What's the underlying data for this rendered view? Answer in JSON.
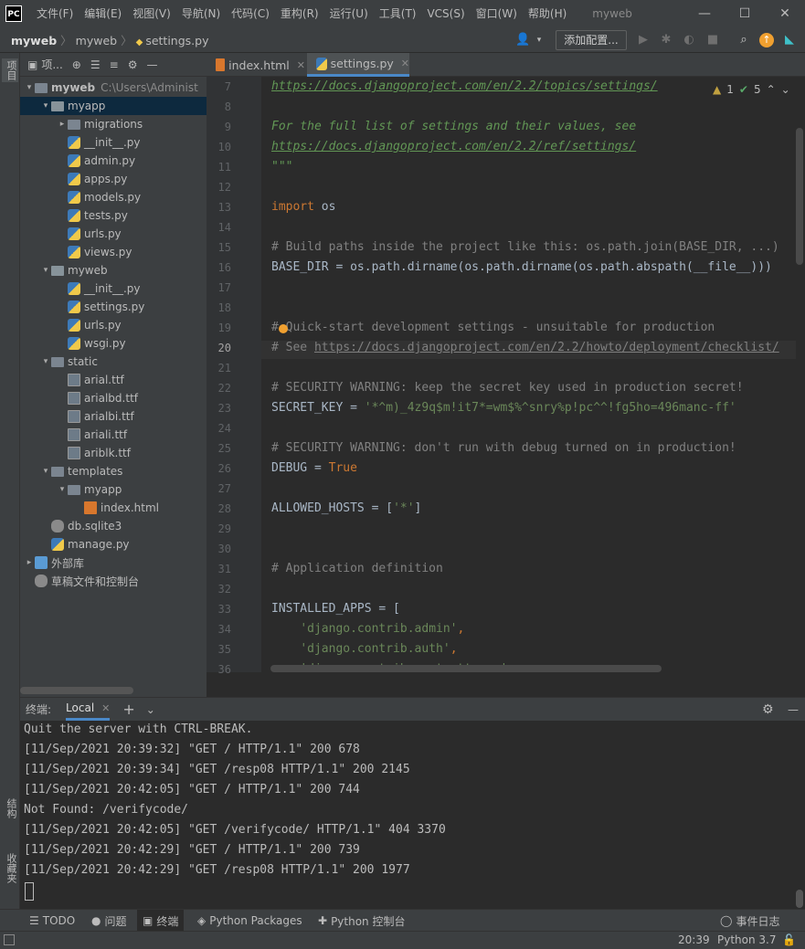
{
  "menubar": {
    "logo": "PC",
    "items": [
      "文件(F)",
      "编辑(E)",
      "视图(V)",
      "导航(N)",
      "代码(C)",
      "重构(R)",
      "运行(U)",
      "工具(T)",
      "VCS(S)",
      "窗口(W)",
      "帮助(H)"
    ],
    "title": "myweb"
  },
  "navbar": {
    "crumbs": [
      "myweb",
      "myweb",
      "settings.py"
    ],
    "run_config": "添加配置..."
  },
  "leftstrip": {
    "project": "项目",
    "structure": "结构",
    "favorites": "收藏夹"
  },
  "project": {
    "header": "项...",
    "tree": [
      {
        "label": "myweb",
        "extra": "C:\\Users\\Administ",
        "indent": 0,
        "arrow": "▾",
        "icon": "folder",
        "bold": true
      },
      {
        "label": "myapp",
        "indent": 1,
        "arrow": "▾",
        "icon": "folder-p",
        "selected": true
      },
      {
        "label": "migrations",
        "indent": 2,
        "arrow": "▸",
        "icon": "folder"
      },
      {
        "label": "__init__.py",
        "indent": 2,
        "icon": "py"
      },
      {
        "label": "admin.py",
        "indent": 2,
        "icon": "py"
      },
      {
        "label": "apps.py",
        "indent": 2,
        "icon": "py"
      },
      {
        "label": "models.py",
        "indent": 2,
        "icon": "py"
      },
      {
        "label": "tests.py",
        "indent": 2,
        "icon": "py"
      },
      {
        "label": "urls.py",
        "indent": 2,
        "icon": "py"
      },
      {
        "label": "views.py",
        "indent": 2,
        "icon": "py"
      },
      {
        "label": "myweb",
        "indent": 1,
        "arrow": "▾",
        "icon": "folder-p"
      },
      {
        "label": "__init__.py",
        "indent": 2,
        "icon": "py"
      },
      {
        "label": "settings.py",
        "indent": 2,
        "icon": "py"
      },
      {
        "label": "urls.py",
        "indent": 2,
        "icon": "py"
      },
      {
        "label": "wsgi.py",
        "indent": 2,
        "icon": "py"
      },
      {
        "label": "static",
        "indent": 1,
        "arrow": "▾",
        "icon": "folder"
      },
      {
        "label": "arial.ttf",
        "indent": 2,
        "icon": "ttf"
      },
      {
        "label": "arialbd.ttf",
        "indent": 2,
        "icon": "ttf"
      },
      {
        "label": "arialbi.ttf",
        "indent": 2,
        "icon": "ttf"
      },
      {
        "label": "ariali.ttf",
        "indent": 2,
        "icon": "ttf"
      },
      {
        "label": "ariblk.ttf",
        "indent": 2,
        "icon": "ttf"
      },
      {
        "label": "templates",
        "indent": 1,
        "arrow": "▾",
        "icon": "folder"
      },
      {
        "label": "myapp",
        "indent": 2,
        "arrow": "▾",
        "icon": "folder"
      },
      {
        "label": "index.html",
        "indent": 3,
        "icon": "html"
      },
      {
        "label": "db.sqlite3",
        "indent": 1,
        "icon": "db"
      },
      {
        "label": "manage.py",
        "indent": 1,
        "icon": "py"
      },
      {
        "label": "外部库",
        "indent": 0,
        "arrow": "▸",
        "icon": "lib"
      },
      {
        "label": "草稿文件和控制台",
        "indent": 0,
        "icon": "scratch"
      }
    ]
  },
  "editor": {
    "tabs": [
      "index.html",
      "settings.py"
    ],
    "warnings": "1",
    "checks": "5",
    "line_numbers": [
      "7",
      "8",
      "9",
      "10",
      "11",
      "12",
      "13",
      "14",
      "15",
      "16",
      "17",
      "18",
      "19",
      "20",
      "21",
      "22",
      "23",
      "24",
      "25",
      "26",
      "27",
      "28",
      "29",
      "30",
      "31",
      "32",
      "33",
      "34",
      "35",
      "36"
    ],
    "lines": {
      "l7": "https://docs.djangoproject.com/en/2.2/topics/settings/",
      "l9": "For the full list of settings and their values, see",
      "l10": "https://docs.djangoproject.com/en/2.2/ref/settings/",
      "l11": "\"\"\"",
      "l13_kw": "import",
      "l13_rest": " os",
      "l15": "# Build paths inside the project like this: os.path.join(BASE_DIR, ...)",
      "l16": "BASE_DIR = os.path.dirname(os.path.dirname(os.path.abspath(__file__)))",
      "l19": "# Quick-start development settings - unsuitable for production",
      "l20_pre": "# See ",
      "l20_link": "https://docs.djangoproject.com/en/2.2/howto/deployment/checklist/",
      "l22": "# SECURITY WARNING: keep the secret key used in production secret!",
      "l23_pre": "SECRET_KEY = ",
      "l23_str": "'*^m)_4z9q$m!it7*=wm$%^snry%p!pc^^!fg5ho=496manc-ff'",
      "l25": "# SECURITY WARNING: don't run with debug turned on in production!",
      "l26_pre": "DEBUG = ",
      "l26_kw": "True",
      "l28_pre": "ALLOWED_HOSTS = [",
      "l28_str": "'*'",
      "l28_post": "]",
      "l31": "# Application definition",
      "l33": "INSTALLED_APPS = [",
      "l34": "'django.contrib.admin'",
      "l35": "'django.contrib.auth'",
      "l36": "'django.contrib.contenttypes'"
    }
  },
  "terminal": {
    "label": "终端:",
    "tab": "Local",
    "lines": [
      "Quit the server with CTRL-BREAK.",
      "[11/Sep/2021 20:39:32] \"GET / HTTP/1.1\" 200 678",
      "[11/Sep/2021 20:39:34] \"GET /resp08 HTTP/1.1\" 200 2145",
      "[11/Sep/2021 20:42:05] \"GET / HTTP/1.1\" 200 744",
      "Not Found: /verifycode/",
      "[11/Sep/2021 20:42:05] \"GET /verifycode/ HTTP/1.1\" 404 3370",
      "[11/Sep/2021 20:42:29] \"GET / HTTP/1.1\" 200 739",
      "[11/Sep/2021 20:42:29] \"GET /resp08 HTTP/1.1\" 200 1977"
    ]
  },
  "bottombar": {
    "todo": "TODO",
    "problems": "问题",
    "terminal": "终端",
    "packages": "Python Packages",
    "console": "Python 控制台",
    "eventlog": "事件日志"
  },
  "statusbar": {
    "position": "20:39",
    "interpreter": "Python 3.7"
  },
  "colors": {
    "accent": "#4a88c7",
    "keyword": "#cc7832",
    "string": "#6a8759",
    "comment": "#808080",
    "docstring": "#629755"
  }
}
